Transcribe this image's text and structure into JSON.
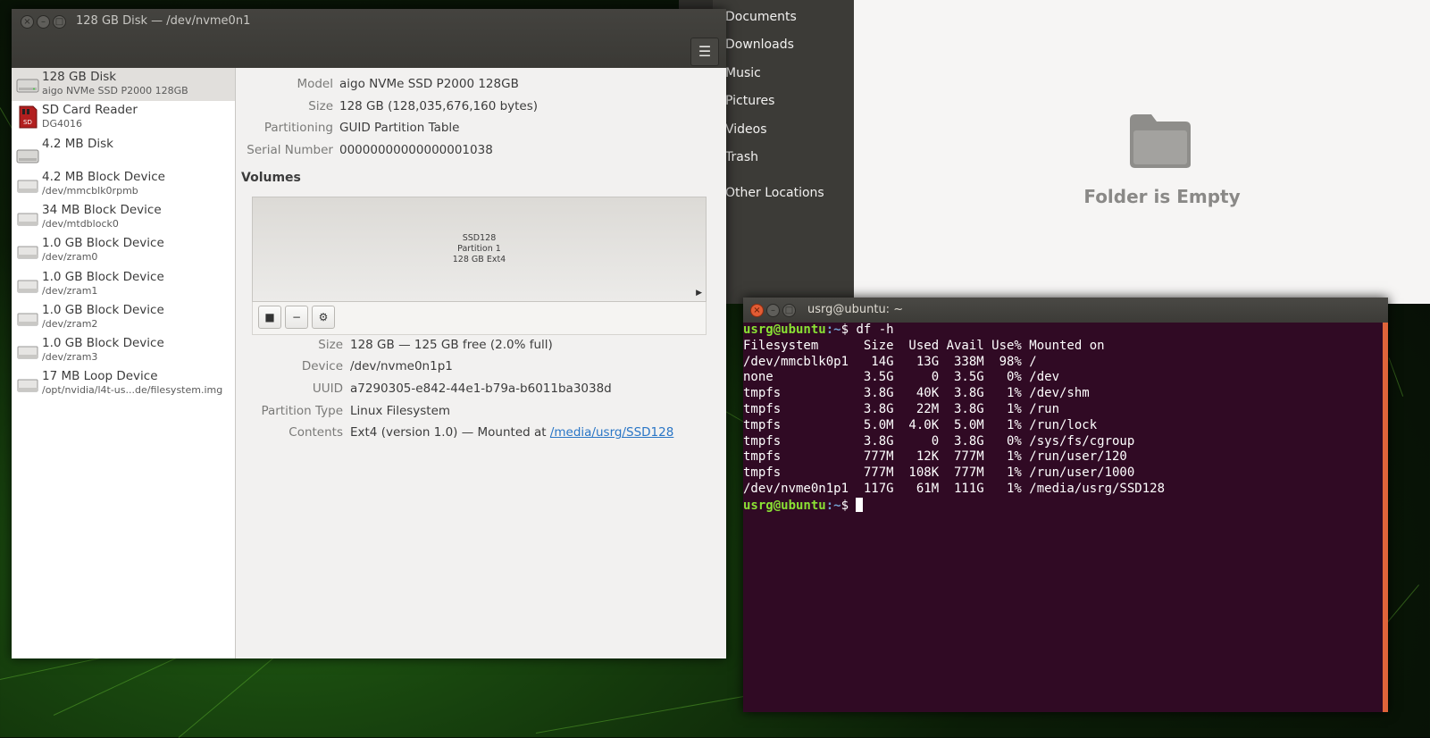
{
  "files": {
    "places": [
      "Documents",
      "Downloads",
      "Music",
      "Pictures",
      "Videos",
      "Trash",
      "Other Locations"
    ],
    "empty_message": "Folder is Empty"
  },
  "disks": {
    "title": "128 GB Disk — /dev/nvme0n1",
    "menu_icon": "hamburger-menu-icon",
    "devices": [
      {
        "name": "128 GB Disk",
        "sub": "aigo NVMe SSD P2000 128GB",
        "icon": "harddisk-icon"
      },
      {
        "name": "SD Card Reader",
        "sub": "DG4016",
        "icon": "sd-card-icon"
      },
      {
        "name": "4.2 MB Disk",
        "sub": "",
        "icon": "harddisk-icon"
      },
      {
        "name": "4.2 MB Block Device",
        "sub": "/dev/mmcblk0rpmb",
        "icon": "block-device-icon"
      },
      {
        "name": "34 MB Block Device",
        "sub": "/dev/mtdblock0",
        "icon": "block-device-icon"
      },
      {
        "name": "1.0 GB Block Device",
        "sub": "/dev/zram0",
        "icon": "block-device-icon"
      },
      {
        "name": "1.0 GB Block Device",
        "sub": "/dev/zram1",
        "icon": "block-device-icon"
      },
      {
        "name": "1.0 GB Block Device",
        "sub": "/dev/zram2",
        "icon": "block-device-icon"
      },
      {
        "name": "1.0 GB Block Device",
        "sub": "/dev/zram3",
        "icon": "block-device-icon"
      },
      {
        "name": "17 MB Loop Device",
        "sub": "/opt/nvidia/l4t-us...de/filesystem.img",
        "icon": "block-device-icon"
      }
    ],
    "drive_info": [
      {
        "label": "Model",
        "value": "aigo NVMe SSD P2000 128GB"
      },
      {
        "label": "Size",
        "value": "128 GB (128,035,676,160 bytes)"
      },
      {
        "label": "Partitioning",
        "value": "GUID Partition Table"
      },
      {
        "label": "Serial Number",
        "value": "00000000000000001038"
      }
    ],
    "volumes_heading": "Volumes",
    "volume": {
      "name": "SSD128",
      "partition": "Partition 1",
      "fs": "128 GB Ext4"
    },
    "toolbar": {
      "stop_icon": "stop-icon",
      "minus_icon": "minus-icon",
      "gear_icon": "gears-icon"
    },
    "volume_info": [
      {
        "label": "Size",
        "value": "128 GB — 125 GB free (2.0% full)"
      },
      {
        "label": "Device",
        "value": "/dev/nvme0n1p1"
      },
      {
        "label": "UUID",
        "value": "a7290305-e842-44e1-b79a-b6011ba3038d"
      },
      {
        "label": "Partition Type",
        "value": "Linux Filesystem"
      },
      {
        "label": "Contents",
        "value": "Ext4 (version 1.0) — Mounted at ",
        "link": "/media/usrg/SSD128"
      }
    ]
  },
  "terminal": {
    "title": "usrg@ubuntu: ~",
    "prompt_user": "usrg@ubuntu",
    "prompt_path": ":~",
    "prompt_sym": "$ ",
    "command": "df -h",
    "output": [
      "Filesystem      Size  Used Avail Use% Mounted on",
      "/dev/mmcblk0p1   14G   13G  338M  98% /",
      "none            3.5G     0  3.5G   0% /dev",
      "tmpfs           3.8G   40K  3.8G   1% /dev/shm",
      "tmpfs           3.8G   22M  3.8G   1% /run",
      "tmpfs           5.0M  4.0K  5.0M   1% /run/lock",
      "tmpfs           3.8G     0  3.8G   0% /sys/fs/cgroup",
      "tmpfs           777M   12K  777M   1% /run/user/120",
      "tmpfs           777M  108K  777M   1% /run/user/1000",
      "/dev/nvme0n1p1  117G   61M  111G   1% /media/usrg/SSD128"
    ]
  }
}
